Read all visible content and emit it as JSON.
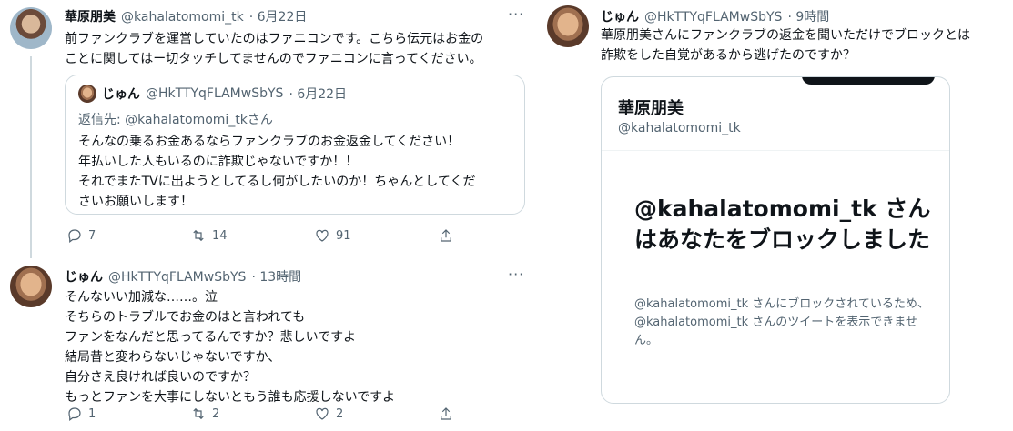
{
  "left": {
    "tweet1": {
      "name": "華原朋美",
      "handle": "@kahalatomomi_tk",
      "date": "· 6月22日",
      "text": "前ファンクラブを運営していたのはファニコンです。こちら伝元はお金の\nことに関してはー切タッチしてませんのでファニコンに言ってください。",
      "quote": {
        "name": "じゅん",
        "handle": "@HkTTYqFLAMwSbYS",
        "date": "· 6月22日",
        "reply_to": "返信先: @kahalatomomi_tkさん",
        "text": "そんなの乗るお金あるならファンクラブのお金返金してください！\n年払いした人もいるのに詐欺じゃないですか！！\nそれでまたTVに出ようとしてるし何がしたいのか！ちゃんとしてくだ\nさいお願いします！"
      },
      "replies": "7",
      "retweets": "14",
      "likes": "91"
    },
    "tweet2": {
      "name": "じゅん",
      "handle": "@HkTTYqFLAMwSbYS",
      "date": "· 13時間",
      "text": "そんないい加減な……。泣\nそちらのトラブルでお金のはと言われても\nファンをなんだと思ってるんですか？悲しいですよ\n結局昔と変わらないじゃないですか、\n自分さえ良ければ良いのですか？\nもっとファンを大事にしないともう誰も応援しないですよ",
      "replies": "1",
      "retweets": "2",
      "likes": "2"
    }
  },
  "right": {
    "tweet": {
      "name": "じゅん",
      "handle": "@HkTTYqFLAMwSbYS",
      "date": "· 9時間",
      "text": "華原朋美さんにファンクラブの返金を聞いただけでブロックとは\n詐欺をした自覚があるから逃げたのですか？"
    },
    "card": {
      "name": "華原朋美",
      "handle": "@kahalatomomi_tk",
      "big": "@kahalatomomi_tk さんはあなたをブロックしました",
      "small": "@kahalatomomi_tk さんにブロックされているため、@kahalatomomi_tk さんのツイートを表示できません。"
    }
  },
  "icons": [
    "more-icon",
    "reply-icon",
    "retweet-icon",
    "like-icon",
    "share-icon"
  ],
  "colors": {
    "text": "#0f1419",
    "secondary": "#536471",
    "border": "#cfd9de"
  }
}
